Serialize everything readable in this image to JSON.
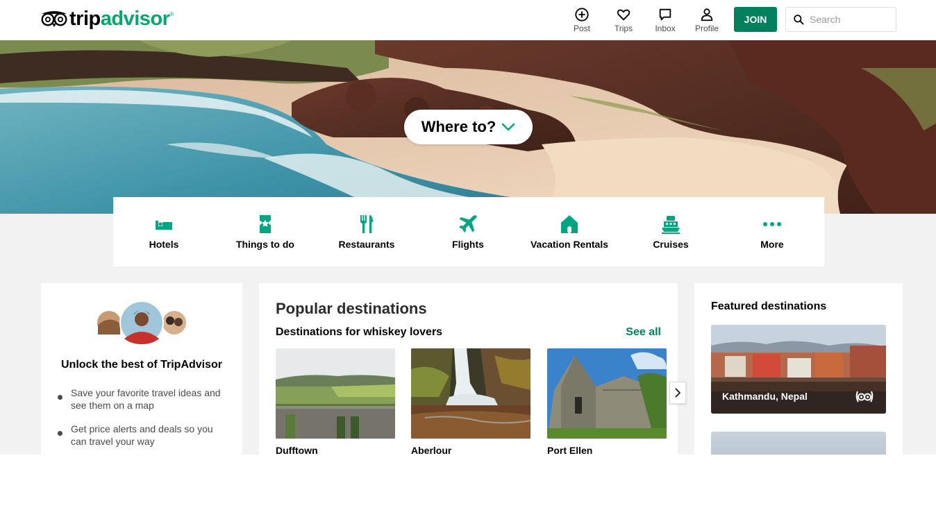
{
  "header": {
    "logo": {
      "trip": "trip",
      "advisor": "advisor",
      "reg": "®"
    },
    "nav": [
      {
        "label": "Post",
        "icon": "plus-circle-icon"
      },
      {
        "label": "Trips",
        "icon": "heart-icon"
      },
      {
        "label": "Inbox",
        "icon": "chat-icon"
      },
      {
        "label": "Profile",
        "icon": "user-icon"
      }
    ],
    "join_label": "JOIN",
    "search_placeholder": "Search"
  },
  "hero": {
    "where_to": "Where to?"
  },
  "categories": [
    {
      "label": "Hotels",
      "icon": "bed-icon"
    },
    {
      "label": "Things to do",
      "icon": "ticket-icon"
    },
    {
      "label": "Restaurants",
      "icon": "fork-knife-icon"
    },
    {
      "label": "Flights",
      "icon": "plane-icon"
    },
    {
      "label": "Vacation Rentals",
      "icon": "house-icon"
    },
    {
      "label": "Cruises",
      "icon": "ship-icon"
    },
    {
      "label": "More",
      "icon": "more-dots-icon"
    }
  ],
  "unlock": {
    "title": "Unlock the best of TripAdvisor",
    "bullets": [
      "Save your favorite travel ideas and see them on a map",
      "Get price alerts and deals so you can travel your way"
    ]
  },
  "popular": {
    "title": "Popular destinations",
    "subtitle": "Destinations for whiskey lovers",
    "see_all": "See all",
    "destinations": [
      {
        "name": "Dufftown"
      },
      {
        "name": "Aberlour"
      },
      {
        "name": "Port Ellen"
      }
    ]
  },
  "featured": {
    "title": "Featured destinations",
    "items": [
      {
        "name": "Kathmandu, Nepal"
      }
    ]
  },
  "colors": {
    "brand_green": "#00aa6c",
    "join_green": "#00805c",
    "icon_green": "#00a680"
  }
}
